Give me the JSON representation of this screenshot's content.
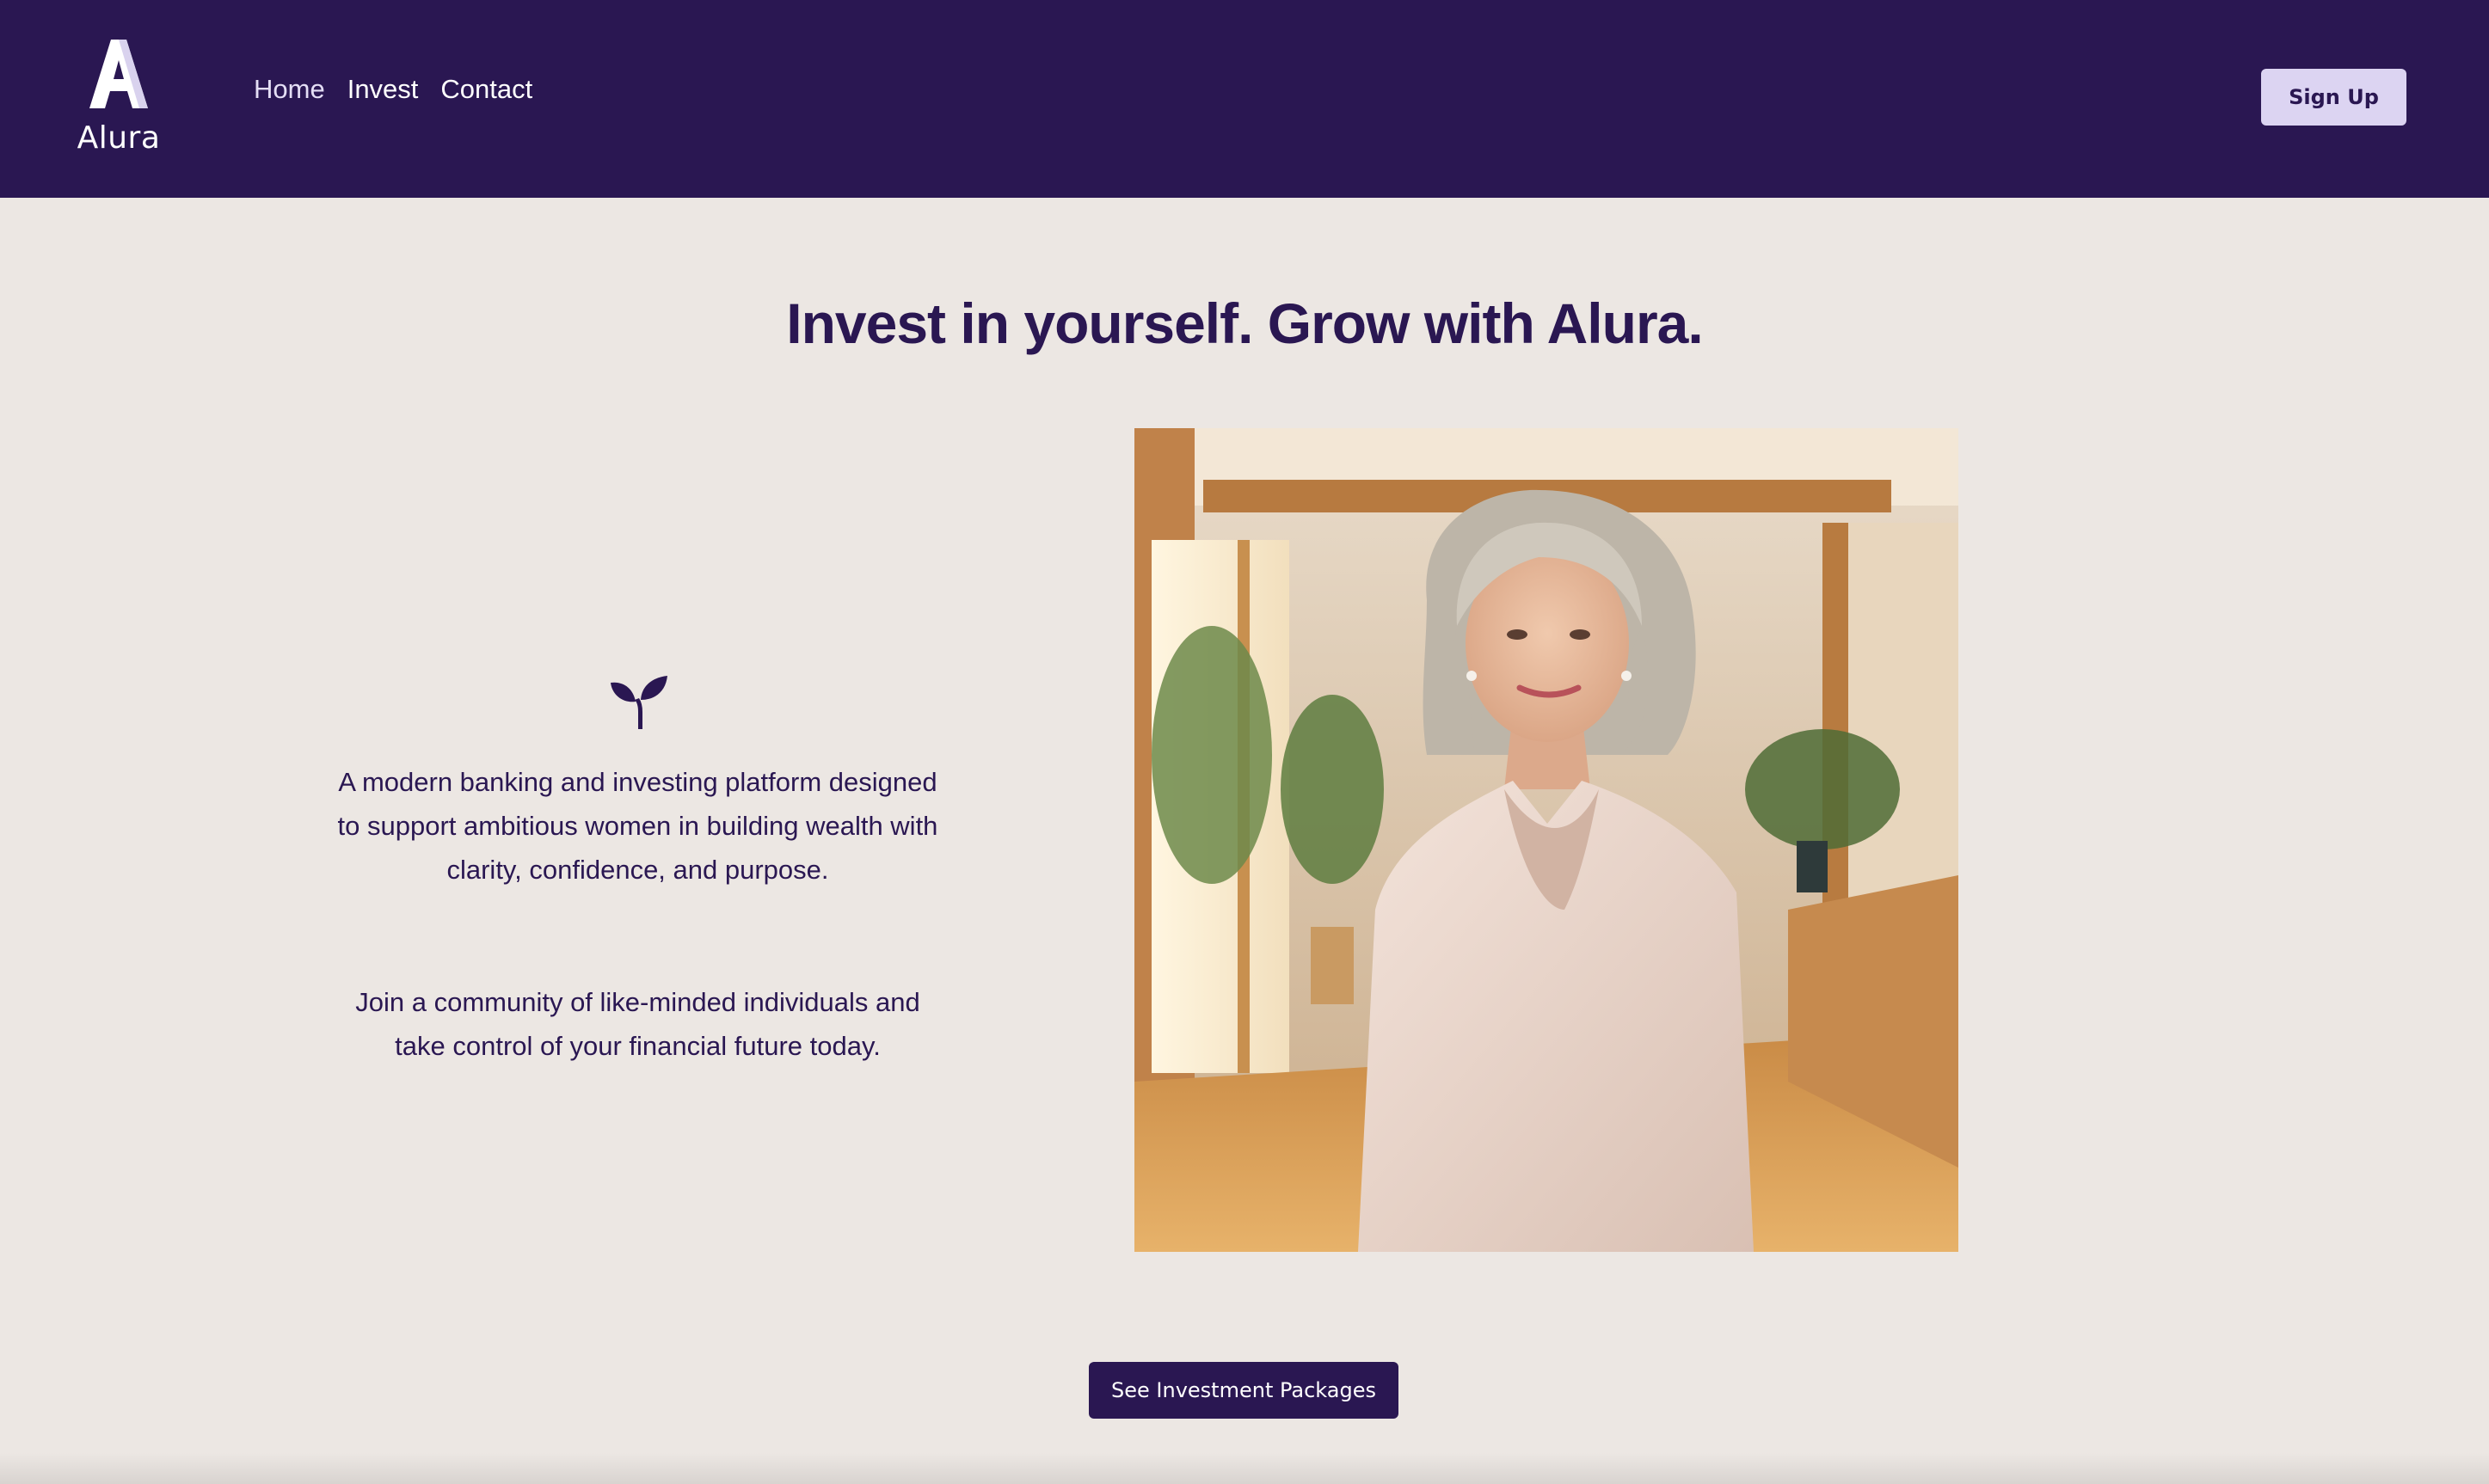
{
  "brand": {
    "name": "Alura",
    "logo_icon": "alura-a-logo-icon"
  },
  "nav": {
    "items": [
      {
        "label": "Home"
      },
      {
        "label": "Invest"
      },
      {
        "label": "Contact"
      }
    ]
  },
  "header": {
    "signup_label": "Sign Up"
  },
  "hero": {
    "headline": "Invest in yourself. Grow with Alura.",
    "icon": "sprout-icon",
    "description_1": "A modern banking and investing platform designed to support ambitious women in building wealth with clarity, confidence, and purpose.",
    "description_2": "Join a community of like-minded individuals and take control of your financial future today.",
    "image": "smiling-woman-portrait",
    "cta_label": "See Investment Packages"
  },
  "colors": {
    "header_bg": "#2a1752",
    "page_bg": "#ece7e3",
    "accent": "#dcd4f2",
    "text": "#2a1752"
  }
}
